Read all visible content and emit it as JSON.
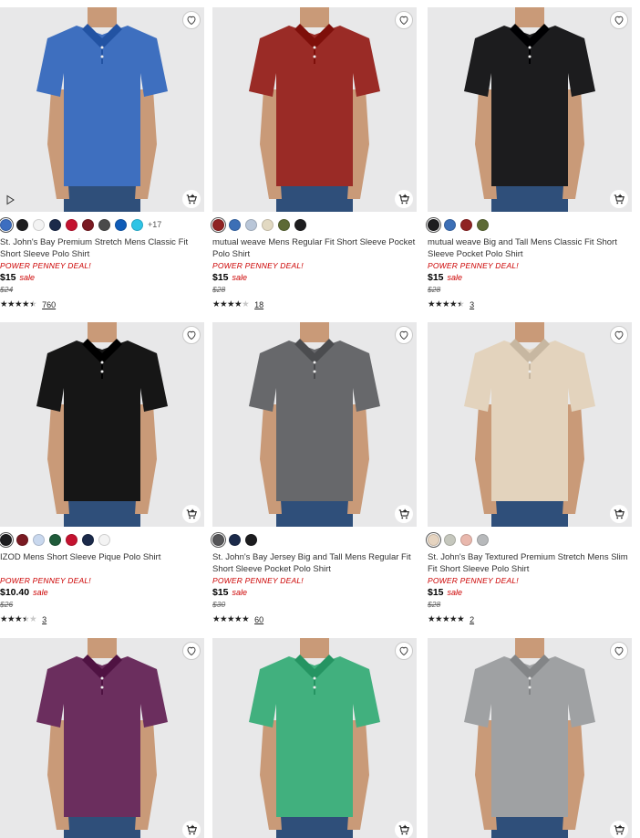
{
  "products": [
    {
      "title": "St. John's Bay Premium Stretch Mens Classic Fit Short Sleeve Polo Shirt",
      "deal": "POWER PENNEY DEAL!",
      "price": "$15",
      "sale_label": "sale",
      "original_price": "$24",
      "rating": 4.5,
      "review_count": "760",
      "shirt_color": "#3e6fbf",
      "has_video": true,
      "more_colors": "+17",
      "swatches": [
        "#3d6ec0",
        "#1d1d1f",
        "#f3f3f3",
        "#1b2a4a",
        "#c4122f",
        "#7a1a22",
        "#4a4a4a",
        "#0f5cb8",
        "#2ec4e6"
      ]
    },
    {
      "title": "mutual weave Mens Regular Fit Short Sleeve Pocket Polo Shirt",
      "deal": "POWER PENNEY DEAL!",
      "price": "$15",
      "sale_label": "sale",
      "original_price": "$28",
      "rating": 4,
      "review_count": "18",
      "shirt_color": "#9a2b26",
      "has_video": false,
      "more_colors": "",
      "swatches": [
        "#8f2323",
        "#3c6fb6",
        "#b9c6d8",
        "#e2d9c2",
        "#5d6a35",
        "#1d1d1f"
      ]
    },
    {
      "title": "mutual weave Big and Tall Mens Classic Fit Short Sleeve Pocket Polo Shirt",
      "deal": "POWER PENNEY DEAL!",
      "price": "$15",
      "sale_label": "sale",
      "original_price": "$28",
      "rating": 4.5,
      "review_count": "3",
      "shirt_color": "#1c1c1e",
      "has_video": false,
      "more_colors": "",
      "swatches": [
        "#1d1d1f",
        "#3c6fb6",
        "#8f2323",
        "#5d6a35"
      ]
    },
    {
      "title": "IZOD Mens Short Sleeve Pique Polo Shirt",
      "deal": "POWER PENNEY DEAL!",
      "price": "$10.40",
      "sale_label": "sale",
      "original_price": "$26",
      "rating": 3.5,
      "review_count": "3",
      "shirt_color": "#161616",
      "has_video": false,
      "more_colors": "",
      "swatches": [
        "#1d1d1f",
        "#7a1a22",
        "#c9d8ee",
        "#1f5b3a",
        "#c4122f",
        "#1b2a4a",
        "#f3f3f3"
      ]
    },
    {
      "title": "St. John's Bay Jersey Big and Tall Mens Regular Fit Short Sleeve Pocket Polo Shirt",
      "deal": "POWER PENNEY DEAL!",
      "price": "$15",
      "sale_label": "sale",
      "original_price": "$30",
      "rating": 5,
      "review_count": "60",
      "shirt_color": "#67686b",
      "has_video": false,
      "more_colors": "",
      "swatches": [
        "#555558",
        "#1b2a4a",
        "#1d1d1f"
      ]
    },
    {
      "title": "St. John's Bay Textured Premium Stretch Mens Slim Fit Short Sleeve Polo Shirt",
      "deal": "POWER PENNEY DEAL!",
      "price": "$15",
      "sale_label": "sale",
      "original_price": "$28",
      "rating": 5,
      "review_count": "2",
      "shirt_color": "#e3d3bd",
      "has_video": false,
      "more_colors": "",
      "swatches": [
        "#e6d4c0",
        "#c5c7bd",
        "#e9b8ad",
        "#b7b9bb"
      ]
    },
    {
      "shirt_color": "#6b2e5e",
      "has_video": false
    },
    {
      "shirt_color": "#41b07e",
      "has_video": false
    },
    {
      "shirt_color": "#9fa1a3",
      "has_video": false
    }
  ],
  "icons": {
    "favorite": "heart-icon",
    "add_to_cart": "cart-icon",
    "video": "play-icon"
  }
}
